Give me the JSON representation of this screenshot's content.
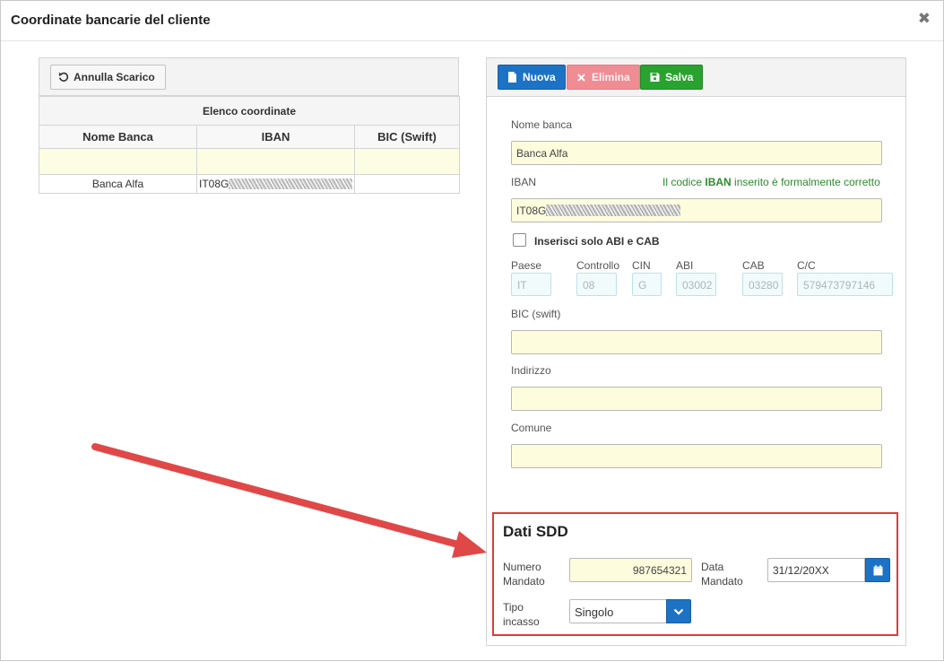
{
  "dialog": {
    "title": "Coordinate bancarie del cliente",
    "close_glyph": "✖"
  },
  "left": {
    "undo_button": "Annulla Scarico",
    "grid_caption": "Elenco coordinate",
    "columns": [
      "Nome Banca",
      "IBAN",
      "BIC (Swift)"
    ],
    "rows": [
      {
        "bank": "Banca Alfa",
        "iban_prefix": "IT08G",
        "bic": ""
      }
    ]
  },
  "toolbar": {
    "new_label": "Nuova",
    "delete_label": "Elimina",
    "save_label": "Salva"
  },
  "form": {
    "bank_name_label": "Nome banca",
    "bank_name_value": "Banca Alfa",
    "iban_label": "IBAN",
    "iban_valid_pre": "Il codice ",
    "iban_valid_bold": "IBAN",
    "iban_valid_post": " inserito è formalmente corretto",
    "iban_prefix": "IT08G",
    "abi_cab_label": "Inserisci solo ABI e CAB",
    "abi_cab_checked": false,
    "paese_label": "Paese",
    "paese_value": "IT",
    "controllo_label": "Controllo",
    "controllo_value": "08",
    "cin_label": "CIN",
    "cin_value": "G",
    "abi_label": "ABI",
    "abi_value": "03002",
    "cab_label": "CAB",
    "cab_value": "03280",
    "cc_label": "C/C",
    "cc_value": "579473797146",
    "bic_label": "BIC (swift)",
    "bic_value": "",
    "address_label": "Indirizzo",
    "address_value": "",
    "city_label": "Comune",
    "city_value": ""
  },
  "sdd": {
    "title": "Dati SDD",
    "mandate_number_label_1": "Numero",
    "mandate_number_label_2": "Mandato",
    "mandate_number_value": "987654321",
    "mandate_date_label_1": "Data",
    "mandate_date_label_2": "Mandato",
    "mandate_date_value": "31/12/20XX",
    "collection_type_label_1": "Tipo",
    "collection_type_label_2": "incasso",
    "collection_type_value": "Singolo"
  },
  "colors": {
    "primary": "#1c73c6",
    "danger": "#f08c93",
    "success": "#2aa22f",
    "highlight_border": "#e03c3c",
    "input_bg": "#fdfdde"
  },
  "icons": {
    "undo": "undo-icon",
    "new": "file-icon",
    "delete": "times-icon",
    "save": "floppy-disk-icon",
    "calendar": "calendar-icon",
    "dropdown": "chevron-down-icon",
    "close": "close-icon"
  }
}
